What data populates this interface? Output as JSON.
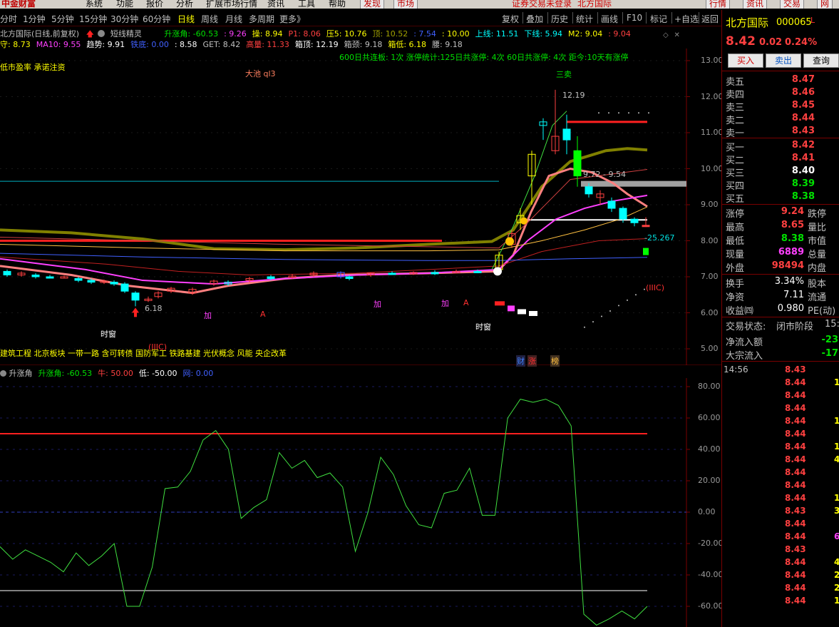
{
  "menu": {
    "logo": "中金财富",
    "items": [
      "系统",
      "功能",
      "报价",
      "分析",
      "扩展市场行情",
      "资讯",
      "工具",
      "帮助"
    ],
    "discover": "发现",
    "market": "市场",
    "login_notice": "证券交易未登录",
    "stock_name_top": "北方国际",
    "right_tabs": [
      "行情",
      "资讯",
      "交易",
      "网"
    ]
  },
  "periods": [
    "分时",
    "1分钟",
    "5分钟",
    "15分钟",
    "30分钟",
    "60分钟",
    "日线",
    "周线",
    "月线",
    "多周期",
    "更多》"
  ],
  "tools": [
    "复权",
    "叠加",
    "历史",
    "统计",
    "画线",
    "F10",
    "标记",
    "+自选",
    "返回"
  ],
  "chart_header": {
    "title": "北方国际(日线,前复权)",
    "indicator_name": "短线精灵",
    "line1": [
      {
        "t": "升涨角: -60.53",
        "c": "#00e000"
      },
      {
        "t": ": 9.26",
        "c": "#ff40ff"
      },
      {
        "t": "操: 8.94",
        "c": "#ffff00"
      },
      {
        "t": "P1: 8.06",
        "c": "#ff4040"
      },
      {
        "t": "压5: 10.76",
        "c": "#ffff00"
      },
      {
        "t": "顶: 10.52",
        "c": "#a0a000"
      },
      {
        "t": ": 7.54",
        "c": "#4060ff"
      },
      {
        "t": ": 10.00",
        "c": "#ffff00"
      },
      {
        "t": "上线: 11.51",
        "c": "#00ffff"
      },
      {
        "t": "下线: 5.94",
        "c": "#00ffff"
      },
      {
        "t": "M2: 9.04",
        "c": "#ffff00"
      },
      {
        "t": ": 9.04",
        "c": "#ff4040"
      }
    ],
    "line2": [
      {
        "t": "守: 8.73",
        "c": "#ffff00"
      },
      {
        "t": "MA10: 9.55",
        "c": "#ff40ff"
      },
      {
        "t": "趋势: 9.91",
        "c": "#ffffff"
      },
      {
        "t": "铁底: 0.00",
        "c": "#4060ff"
      },
      {
        "t": ": 8.58",
        "c": "#ffffff"
      },
      {
        "t": "GET: 8.42",
        "c": "#c0c0c0"
      },
      {
        "t": "高量: 11.33",
        "c": "#ff4040"
      },
      {
        "t": "箱顶: 12.19",
        "c": "#ffffff"
      },
      {
        "t": "箱颈: 9.18",
        "c": "#c0c0c0"
      },
      {
        "t": "箱低: 6.18",
        "c": "#ffff00"
      },
      {
        "t": "腰: 9.18",
        "c": "#c0c0c0"
      }
    ],
    "stats": "600日共连板: 1次   涨停统计:125日共涨停: 4次   60日共涨停: 4次   距今:10天有涨停",
    "concepts_top": "低市盈率 承诺注资",
    "big_pool": "大池 ql3",
    "sell3": "三卖",
    "concepts_bottom": "建筑工程 北京板块 一带一路 含可转债 国防军工 铁路基建 光伏概念 风能 央企改革",
    "shichuang_1": "时窗",
    "shichuang_2": "时窗",
    "mark_high": "12.19",
    "mark_low": "6.18",
    "mark_range": "9.72 - 9.54",
    "mark_pct": "-25.267",
    "mark_iiic": "(IIIC)",
    "mark_iiic2": "(IIIC)",
    "mark_add1": "加",
    "mark_add2": "加",
    "mark_add3": "加",
    "mark_a1": "A",
    "mark_a2": "A",
    "mark_cai": "财",
    "mark_zhang": "涨",
    "mark_bang": "榜"
  },
  "price_axis": [
    "13.00",
    "12.00",
    "11.00",
    "10.00",
    "9.00",
    "8.00",
    "7.00",
    "6.00",
    "5.00"
  ],
  "osc_header": [
    {
      "t": "升涨角",
      "c": "#c0c0c0"
    },
    {
      "t": "升涨角: -60.53",
      "c": "#00e000"
    },
    {
      "t": "牛: 50.00",
      "c": "#ff4040"
    },
    {
      "t": "低: -50.00",
      "c": "#ffffff"
    },
    {
      "t": "网: 0.00",
      "c": "#4060ff"
    }
  ],
  "osc_axis": [
    "80.00",
    "60.00",
    "40.00",
    "20.00",
    "0.00",
    "-20.00",
    "-40.00",
    "-60.00"
  ],
  "osc_values": [
    -22,
    -30,
    -24,
    -28,
    -32,
    -38,
    -26,
    -34,
    -28,
    -20,
    -60,
    -60,
    -35,
    15,
    16,
    26,
    46,
    52,
    40,
    -4,
    3,
    8,
    38,
    28,
    33,
    22,
    25,
    16,
    -25,
    0,
    35,
    24,
    4,
    -8,
    -10,
    12,
    14,
    28,
    -2,
    -2,
    60,
    72,
    70,
    72,
    68,
    55,
    -65,
    -72,
    -68,
    -63,
    -68,
    -60
  ],
  "stock": {
    "name": "北方国际",
    "code": "000065",
    "flag": "L",
    "price": "8.42",
    "change": "0.02",
    "pct": "0.24%",
    "buy_label": "买入",
    "sell_label": "卖出",
    "query_label": "查询"
  },
  "orderbook": {
    "asks": [
      {
        "label": "卖五",
        "price": "8.47"
      },
      {
        "label": "卖四",
        "price": "8.46"
      },
      {
        "label": "卖三",
        "price": "8.45"
      },
      {
        "label": "卖二",
        "price": "8.44"
      },
      {
        "label": "卖一",
        "price": "8.43"
      }
    ],
    "bids": [
      {
        "label": "买一",
        "price": "8.42",
        "cls": "red"
      },
      {
        "label": "买二",
        "price": "8.41",
        "cls": "red"
      },
      {
        "label": "买三",
        "price": "8.40",
        "cls": "wht"
      },
      {
        "label": "买四",
        "price": "8.39",
        "cls": "grn"
      },
      {
        "label": "买五",
        "price": "8.38",
        "cls": "grn"
      }
    ]
  },
  "quote_stats": [
    {
      "l": "涨停",
      "v": "9.24",
      "vc": "red",
      "l2": "跌停"
    },
    {
      "l": "最高",
      "v": "8.65",
      "vc": "red",
      "l2": "量比"
    },
    {
      "l": "最低",
      "v": "8.38",
      "vc": "grn",
      "l2": "市值"
    },
    {
      "l": "现量",
      "v": "6889",
      "vc": "mag",
      "l2": "总量"
    },
    {
      "l": "外盘",
      "v": "98494",
      "vc": "red",
      "l2": "内盘"
    }
  ],
  "extra_stats": [
    {
      "l": "换手",
      "v": "3.34%",
      "l2": "股本"
    },
    {
      "l": "净资",
      "v": "7.11",
      "l2": "流通"
    },
    {
      "l": "收益㈣",
      "v": "0.980",
      "l2": "PE(动)"
    }
  ],
  "trade_state": {
    "label": "交易状态:",
    "value": "闭市阶段",
    "tail": "15:"
  },
  "flows": [
    {
      "l": "净流入额",
      "v": "-23"
    },
    {
      "l": "大宗流入",
      "v": "-17"
    }
  ],
  "ticks": {
    "time": "14:56",
    "prices": [
      "8.43",
      "8.44",
      "8.44",
      "8.44",
      "8.44",
      "8.44",
      "8.44",
      "8.44",
      "8.44",
      "8.44",
      "8.44",
      "8.43",
      "8.44",
      "8.44",
      "8.43",
      "8.44",
      "8.44",
      "8.44",
      "8.44"
    ],
    "vols": [
      "",
      "1",
      "",
      "",
      "1",
      "",
      "1",
      "4",
      "",
      "",
      "1",
      "3",
      "",
      "6",
      "",
      "4",
      "2",
      "2",
      "1"
    ]
  }
}
